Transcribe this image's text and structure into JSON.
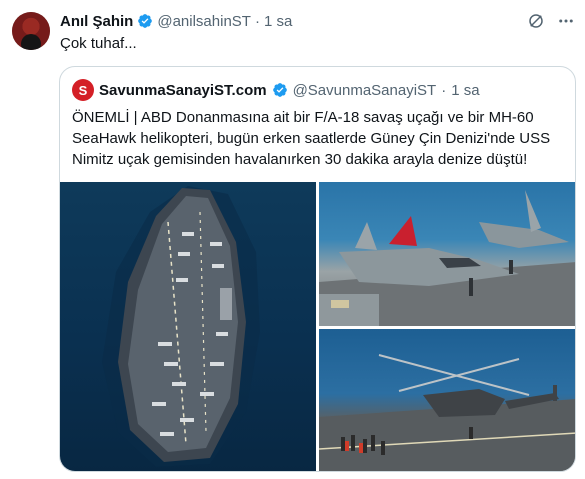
{
  "tweet": {
    "author_name": "Anıl Şahin",
    "handle": "@anilsahinST",
    "separator": "·",
    "time": "1 sa",
    "text": "Çok tuhaf...",
    "icons": [
      "verified-badge-icon",
      "grok-icon",
      "more-icon"
    ]
  },
  "quote": {
    "avatar_letter": "S",
    "author_name": "SavunmaSanayiST.com",
    "handle": "@SavunmaSanayiST",
    "separator": "·",
    "time": "1 sa",
    "text": "ÖNEMLİ | ABD Donanmasına ait bir F/A-18 savaş uçağı ve bir MH-60 SeaHawk helikopteri, bugün erken saatlerde Güney Çin Denizi'nde USS Nimitz uçak gemisinden havalanırken 30 dakika arayla denize düştü!",
    "images": [
      "aircraft-carrier-photo",
      "fa18-jet-on-deck-photo",
      "mh60-helicopter-on-deck-photo"
    ]
  },
  "colors": {
    "verified": "#1d9bf0",
    "secondary_text": "#536471",
    "border": "#cfd9de",
    "brand_red": "#d41f26"
  }
}
